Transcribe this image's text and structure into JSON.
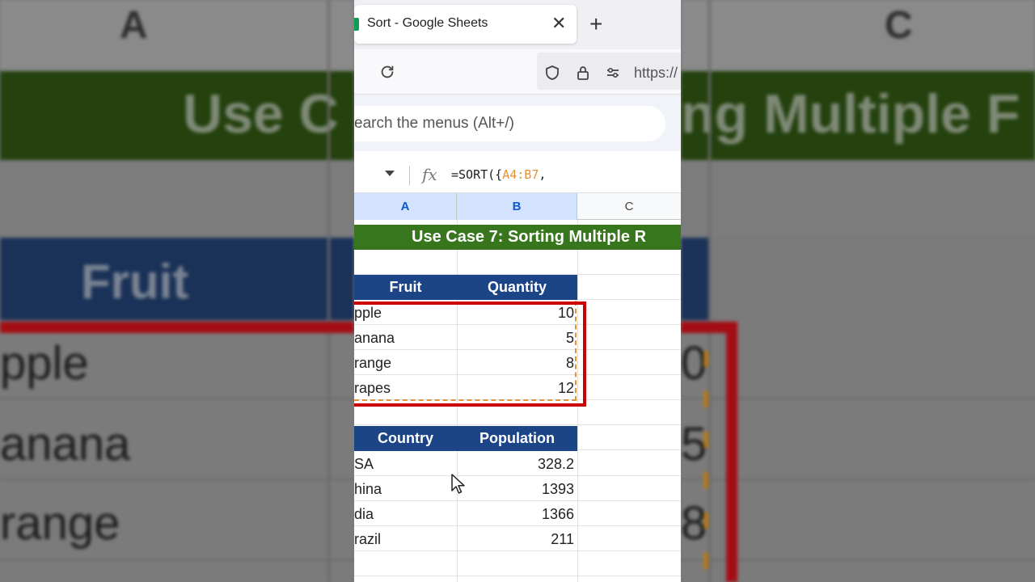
{
  "background": {
    "col_a": "A",
    "col_c": "C",
    "banner_left": "Use C",
    "banner_right": "ng Multiple F",
    "fruit_header": "Fruit",
    "rows_left": [
      "pple",
      "anana",
      "range"
    ],
    "digits_right": [
      "0",
      "5",
      "8"
    ]
  },
  "browser": {
    "tab_title": "Sort - Google Sheets",
    "close_glyph": "✕",
    "newtab_glyph": "+",
    "url": "https://"
  },
  "sheets": {
    "search_placeholder": "earch the menus (Alt+/)",
    "fx_label": "fx",
    "formula_prefix": "=SORT({",
    "formula_ref": "A4:B7",
    "formula_suffix": ",",
    "columns": [
      "A",
      "B",
      "C"
    ],
    "title": "Use Case 7: Sorting Multiple R",
    "fruit_table": {
      "headers": [
        "Fruit",
        "Quantity"
      ],
      "rows": [
        [
          "pple",
          "10"
        ],
        [
          "anana",
          "5"
        ],
        [
          "range",
          "8"
        ],
        [
          "rapes",
          "12"
        ]
      ]
    },
    "country_table": {
      "headers": [
        "Country",
        "Population"
      ],
      "rows": [
        [
          "SA",
          "328.2"
        ],
        [
          "hina",
          "1393"
        ],
        [
          "dia",
          "1366"
        ],
        [
          "razil",
          "211"
        ]
      ]
    }
  },
  "colors": {
    "title_green": "#38761d",
    "header_blue": "#1c4587",
    "selection_red": "#cc0000",
    "formula_ref_orange": "#e69138"
  }
}
